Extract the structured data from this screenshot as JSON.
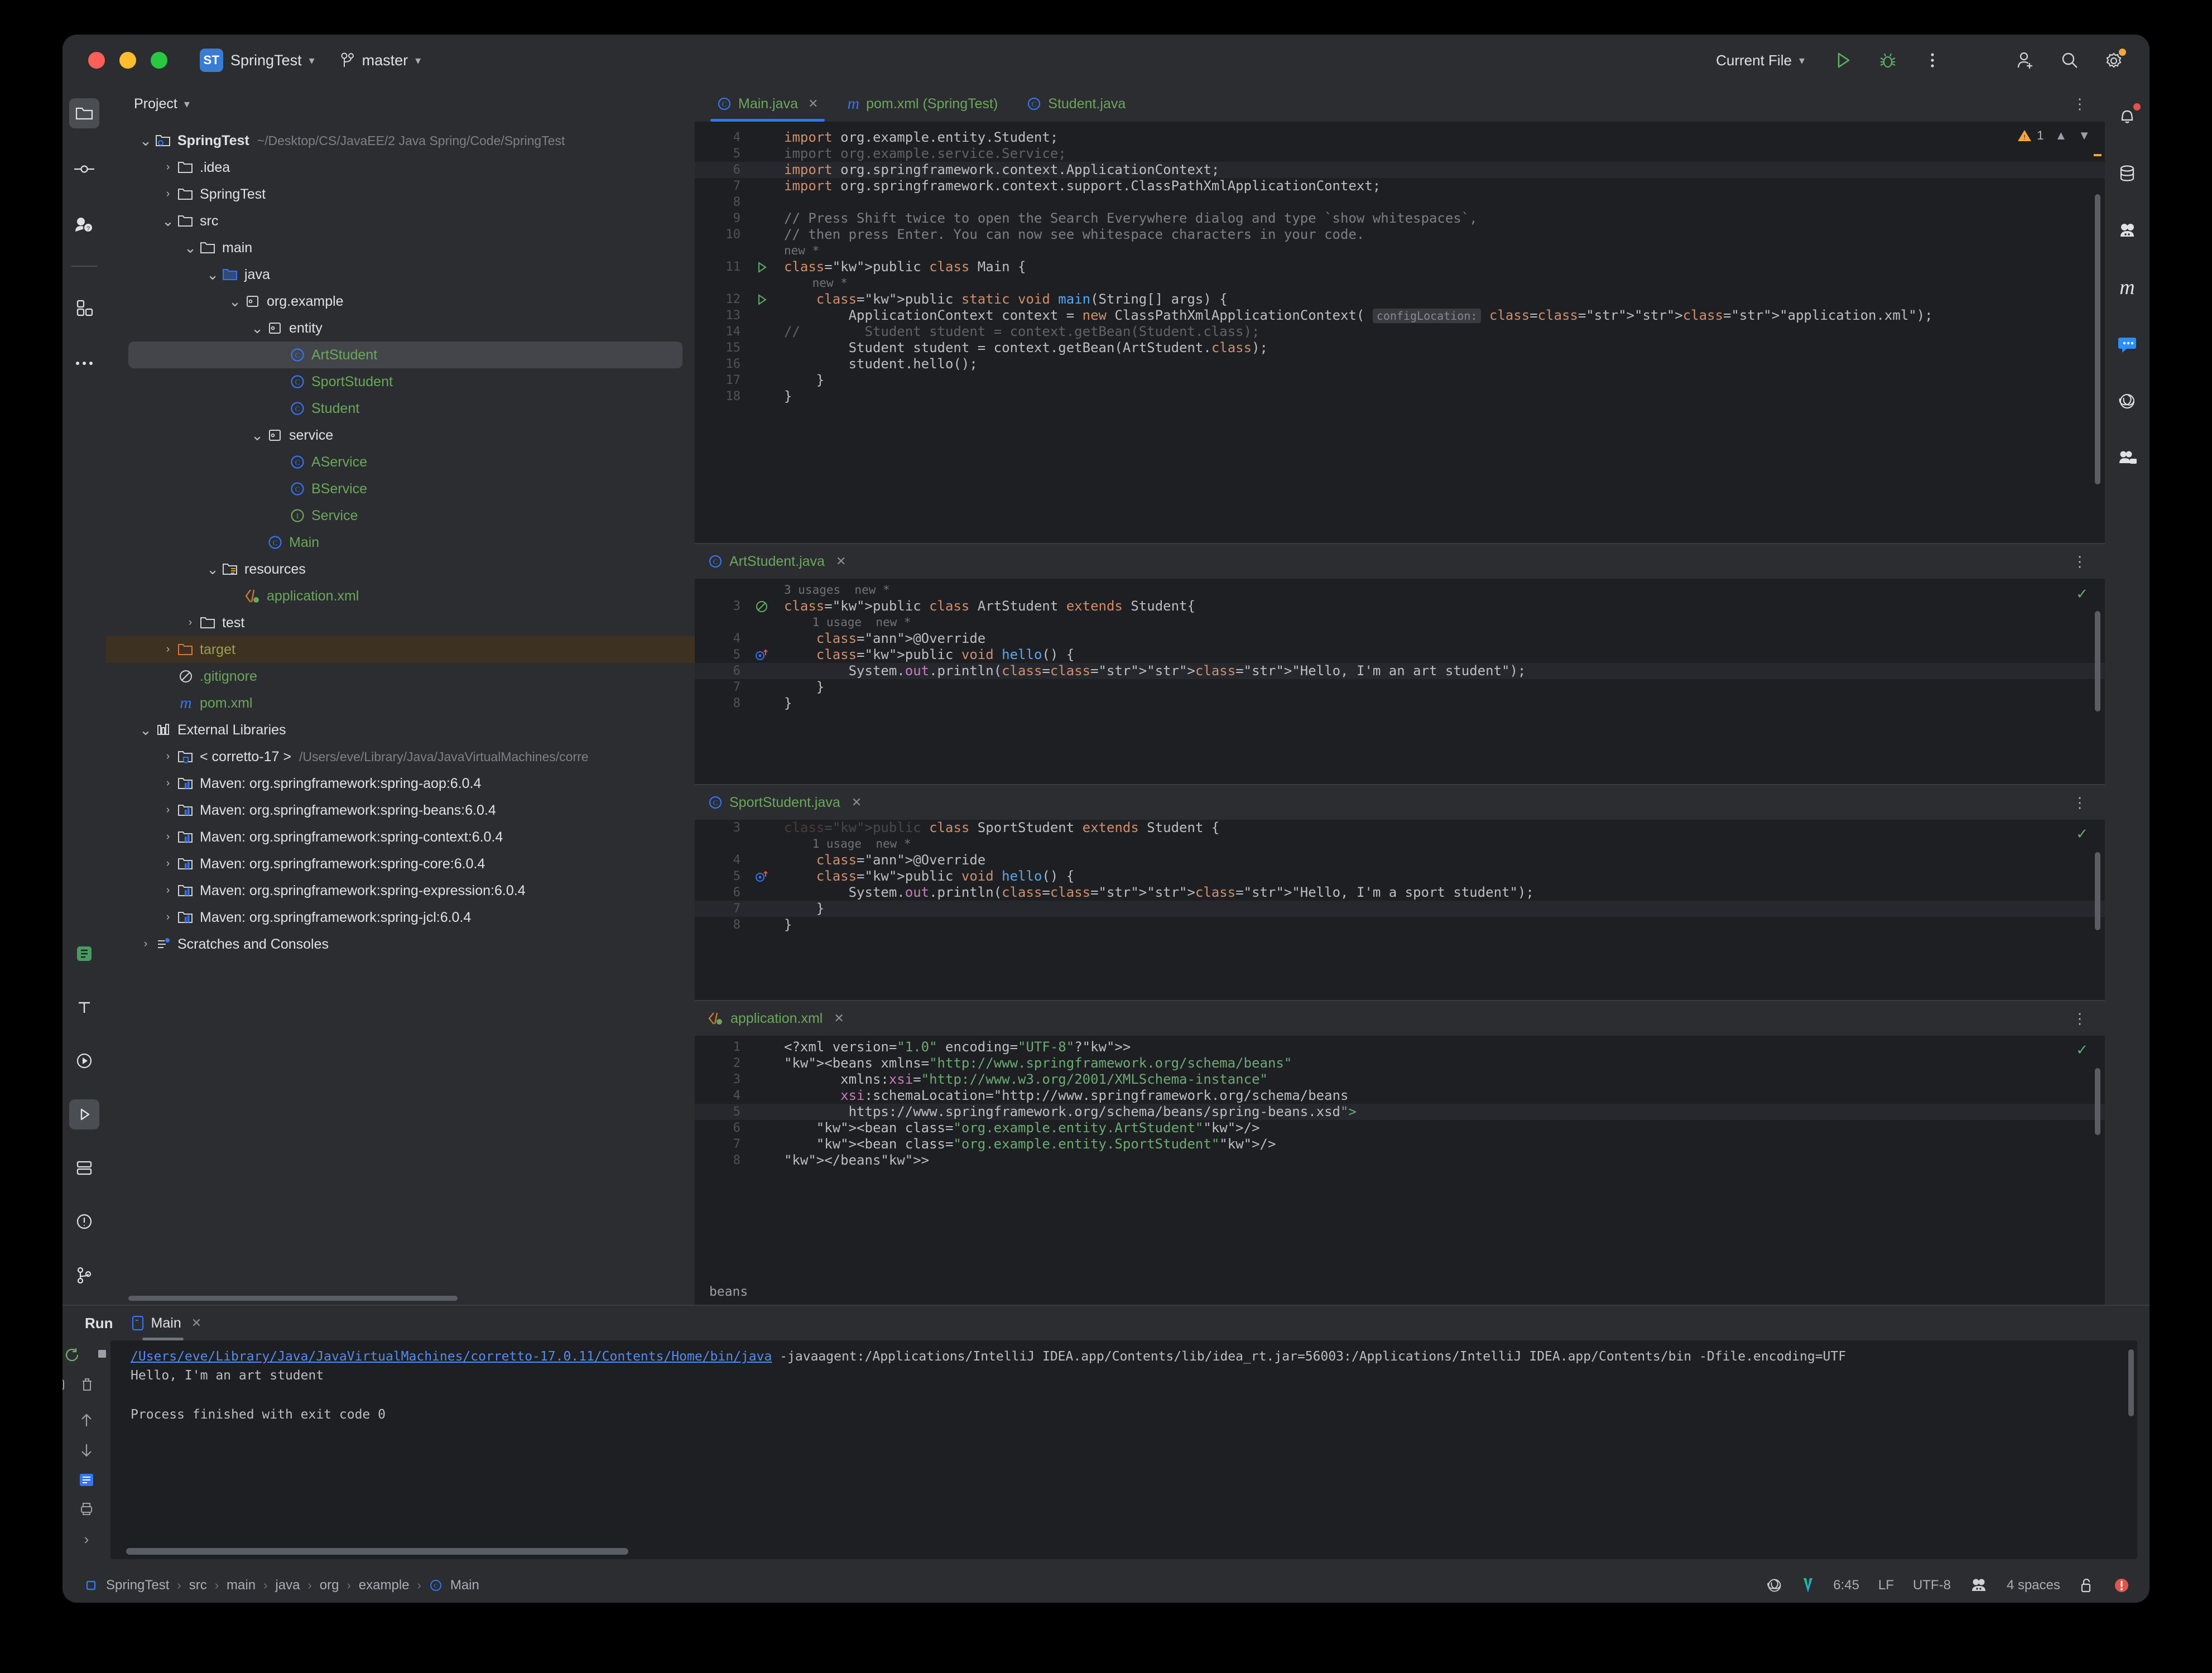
{
  "titlebar": {
    "project_badge": "ST",
    "project_name": "SpringTest",
    "branch": "master",
    "run_config": "Current File",
    "icons": [
      "run-icon",
      "debug-icon",
      "more-actions-icon",
      "add-user-icon",
      "search-icon",
      "settings-icon"
    ]
  },
  "left_rail": [
    "project-icon",
    "commit-icon",
    "pull-requests-icon",
    "structure-icon",
    "more-tool-windows-icon",
    "database-bottom-icon",
    "terminal-icon",
    "run-icon",
    "services-icon",
    "problems-icon",
    "git-icon"
  ],
  "right_rail": [
    "notifications-icon",
    "database-icon",
    "ai-assistant-icon",
    "maven-icon",
    "chat-icon",
    "openai-icon",
    "meeting-icon"
  ],
  "project": {
    "header": "Project",
    "tree": [
      {
        "depth": 0,
        "arrow": "v",
        "icon": "module-folder-icon",
        "label": "SpringTest",
        "style": "white bold",
        "hint": "~/Desktop/CS/JavaEE/2 Java Spring/Code/SpringTest"
      },
      {
        "depth": 1,
        "arrow": ">",
        "icon": "folder-icon",
        "label": ".idea",
        "style": "white"
      },
      {
        "depth": 1,
        "arrow": ">",
        "icon": "folder-icon",
        "label": "SpringTest",
        "style": "white"
      },
      {
        "depth": 1,
        "arrow": "v",
        "icon": "folder-icon",
        "label": "src",
        "style": "white"
      },
      {
        "depth": 2,
        "arrow": "v",
        "icon": "folder-icon",
        "label": "main",
        "style": "white"
      },
      {
        "depth": 3,
        "arrow": "v",
        "icon": "source-folder-icon",
        "label": "java",
        "style": "white"
      },
      {
        "depth": 4,
        "arrow": "v",
        "icon": "package-icon",
        "label": "org.example",
        "style": "white"
      },
      {
        "depth": 5,
        "arrow": "v",
        "icon": "package-icon",
        "label": "entity",
        "style": "white"
      },
      {
        "depth": 6,
        "arrow": "",
        "icon": "class-icon",
        "label": "ArtStudent",
        "style": "green",
        "selected": true
      },
      {
        "depth": 6,
        "arrow": "",
        "icon": "class-icon",
        "label": "SportStudent",
        "style": "green"
      },
      {
        "depth": 6,
        "arrow": "",
        "icon": "class-icon",
        "label": "Student",
        "style": "green"
      },
      {
        "depth": 5,
        "arrow": "v",
        "icon": "package-icon",
        "label": "service",
        "style": "white"
      },
      {
        "depth": 6,
        "arrow": "",
        "icon": "class-icon",
        "label": "AService",
        "style": "green"
      },
      {
        "depth": 6,
        "arrow": "",
        "icon": "class-icon",
        "label": "BService",
        "style": "green"
      },
      {
        "depth": 6,
        "arrow": "",
        "icon": "interface-icon",
        "label": "Service",
        "style": "green"
      },
      {
        "depth": 5,
        "arrow": "",
        "icon": "class-icon",
        "label": "Main",
        "style": "green"
      },
      {
        "depth": 3,
        "arrow": "v",
        "icon": "resources-folder-icon",
        "label": "resources",
        "style": "white"
      },
      {
        "depth": 4,
        "arrow": "",
        "icon": "spring-xml-icon",
        "label": "application.xml",
        "style": "green"
      },
      {
        "depth": 2,
        "arrow": ">",
        "icon": "folder-icon",
        "label": "test",
        "style": "white"
      },
      {
        "depth": 1,
        "arrow": ">",
        "icon": "excluded-folder-icon",
        "label": "target",
        "style": "olive",
        "target": true
      },
      {
        "depth": 1,
        "arrow": "",
        "icon": "gitignore-icon",
        "label": ".gitignore",
        "style": "green"
      },
      {
        "depth": 1,
        "arrow": "",
        "icon": "maven-pom-icon",
        "label": "pom.xml",
        "style": "green"
      },
      {
        "depth": 0,
        "arrow": "v",
        "icon": "external-libraries-icon",
        "label": "External Libraries",
        "style": "white"
      },
      {
        "depth": 1,
        "arrow": ">",
        "icon": "jdk-icon",
        "label": "< corretto-17 >",
        "style": "white",
        "hint": "/Users/eve/Library/Java/JavaVirtualMachines/corre"
      },
      {
        "depth": 1,
        "arrow": ">",
        "icon": "library-icon",
        "label": "Maven: org.springframework:spring-aop:6.0.4",
        "style": "white"
      },
      {
        "depth": 1,
        "arrow": ">",
        "icon": "library-icon",
        "label": "Maven: org.springframework:spring-beans:6.0.4",
        "style": "white"
      },
      {
        "depth": 1,
        "arrow": ">",
        "icon": "library-icon",
        "label": "Maven: org.springframework:spring-context:6.0.4",
        "style": "white"
      },
      {
        "depth": 1,
        "arrow": ">",
        "icon": "library-icon",
        "label": "Maven: org.springframework:spring-core:6.0.4",
        "style": "white"
      },
      {
        "depth": 1,
        "arrow": ">",
        "icon": "library-icon",
        "label": "Maven: org.springframework:spring-expression:6.0.4",
        "style": "white"
      },
      {
        "depth": 1,
        "arrow": ">",
        "icon": "library-icon",
        "label": "Maven: org.springframework:spring-jcl:6.0.4",
        "style": "white"
      },
      {
        "depth": 0,
        "arrow": ">",
        "icon": "scratches-icon",
        "label": "Scratches and Consoles",
        "style": "white"
      }
    ]
  },
  "editor_tabs": [
    {
      "label": "Main.java",
      "icon": "class-icon",
      "active": true,
      "closable": true
    },
    {
      "label": "pom.xml (SpringTest)",
      "icon": "maven-pom-icon",
      "active": false,
      "closable": false
    },
    {
      "label": "Student.java",
      "icon": "class-icon",
      "active": false,
      "closable": false
    }
  ],
  "main_editor": {
    "warning_count": "1",
    "lines": [
      {
        "n": "4",
        "t": "import org.example.entity.Student;"
      },
      {
        "n": "5",
        "t": "import org.example.service.Service;",
        "dim": true
      },
      {
        "n": "6",
        "t": "import org.springframework.context.ApplicationContext;",
        "highlight": true
      },
      {
        "n": "7",
        "t": "import org.springframework.context.support.ClassPathXmlApplicationContext;"
      },
      {
        "n": "8",
        "t": ""
      },
      {
        "n": "9",
        "t": "// Press Shift twice to open the Search Everywhere dialog and type `show whitespaces`,"
      },
      {
        "n": "10",
        "t": "// then press Enter. You can now see whitespace characters in your code."
      },
      {
        "n": "",
        "t": "new *",
        "inlay": true
      },
      {
        "n": "11",
        "t": "public class Main {",
        "gutter": "run"
      },
      {
        "n": "",
        "t": "    new *",
        "inlay": true
      },
      {
        "n": "12",
        "t": "    public static void main(String[] args) {",
        "gutter": "run"
      },
      {
        "n": "13",
        "t": "        ApplicationContext context = new ClassPathXmlApplicationContext( configLocation: \"application.xml\");"
      },
      {
        "n": "14",
        "t": "//        Student student = context.getBean(Student.class);",
        "dim": true
      },
      {
        "n": "15",
        "t": "        Student student = context.getBean(ArtStudent.class);"
      },
      {
        "n": "16",
        "t": "        student.hello();"
      },
      {
        "n": "17",
        "t": "    }"
      },
      {
        "n": "18",
        "t": "}"
      }
    ]
  },
  "art_student_pane": {
    "tab": "ArtStudent.java",
    "lines": [
      {
        "n": "",
        "t": "3 usages  new *",
        "inlay": true
      },
      {
        "n": "3",
        "t": "public class ArtStudent extends Student{",
        "gutter": "override-class"
      },
      {
        "n": "",
        "t": "    1 usage  new *",
        "inlay": true
      },
      {
        "n": "4",
        "t": "    @Override"
      },
      {
        "n": "5",
        "t": "    public void hello() {",
        "gutter": "override-method"
      },
      {
        "n": "6",
        "t": "        System.out.println(\"Hello, I'm an art student\");",
        "highlight": true
      },
      {
        "n": "7",
        "t": "    }"
      },
      {
        "n": "8",
        "t": "}"
      }
    ]
  },
  "sport_student_pane": {
    "tab": "SportStudent.java",
    "lines": [
      {
        "n": "3",
        "t": "public class SportStudent extends Student {",
        "clipped": true
      },
      {
        "n": "",
        "t": "    1 usage  new *",
        "inlay": true
      },
      {
        "n": "4",
        "t": "    @Override"
      },
      {
        "n": "5",
        "t": "    public void hello() {",
        "gutter": "override-method"
      },
      {
        "n": "6",
        "t": "        System.out.println(\"Hello, I'm a sport student\");"
      },
      {
        "n": "7",
        "t": "    }",
        "highlight": true
      },
      {
        "n": "8",
        "t": "}"
      }
    ]
  },
  "application_xml_pane": {
    "tab": "application.xml",
    "breadcrumb": "beans",
    "lines": [
      {
        "n": "1",
        "t": "<?xml version=\"1.0\" encoding=\"UTF-8\"?>"
      },
      {
        "n": "2",
        "t": "<beans xmlns=\"http://www.springframework.org/schema/beans\""
      },
      {
        "n": "3",
        "t": "       xmlns:xsi=\"http://www.w3.org/2001/XMLSchema-instance\""
      },
      {
        "n": "4",
        "t": "       xsi:schemaLocation=\"http://www.springframework.org/schema/beans"
      },
      {
        "n": "5",
        "t": "        https://www.springframework.org/schema/beans/spring-beans.xsd\">",
        "highlight": true
      },
      {
        "n": "6",
        "t": "    <bean class=\"org.example.entity.ArtStudent\"/>"
      },
      {
        "n": "7",
        "t": "    <bean class=\"org.example.entity.SportStudent\"/>"
      },
      {
        "n": "8",
        "t": "</beans>"
      }
    ]
  },
  "run_window": {
    "title": "Run",
    "tab": "Main",
    "console": {
      "command_link": "/Users/eve/Library/Java/JavaVirtualMachines/corretto-17.0.11/Contents/Home/bin/java",
      "command_rest": " -javaagent:/Applications/IntelliJ IDEA.app/Contents/lib/idea_rt.jar=56003:/Applications/IntelliJ IDEA.app/Contents/bin -Dfile.encoding=UTF",
      "output": "Hello, I'm an art student",
      "exit": "Process finished with exit code 0"
    },
    "rail_icons": [
      "rerun-icon",
      "stop-icon",
      "screenshot-icon",
      "trash-icon",
      "more-icon",
      "scroll-up-icon",
      "scroll-down-icon",
      "soft-wrap-icon",
      "print-icon",
      "expand-icon"
    ]
  },
  "status_bar": {
    "breadcrumbs": [
      "SpringTest",
      "src",
      "main",
      "java",
      "org",
      "example",
      "Main"
    ],
    "caret": "6:45",
    "line_ending": "LF",
    "encoding": "UTF-8",
    "indent": "4 spaces",
    "icons": [
      "openai-icon",
      "vpn-icon",
      "ai-icon",
      "lock-icon",
      "error-icon"
    ]
  }
}
